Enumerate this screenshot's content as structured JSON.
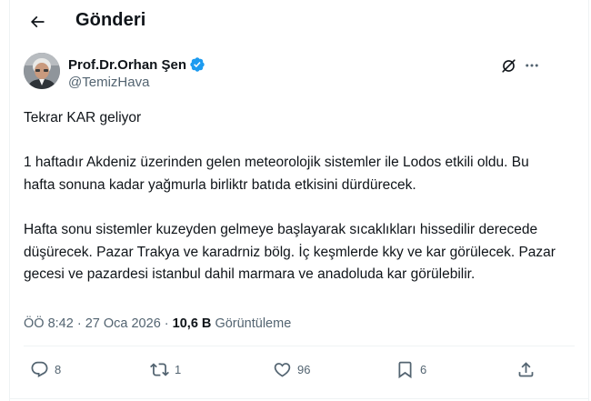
{
  "header": {
    "back_icon": "arrow-left-icon",
    "title": "Gönderi"
  },
  "author": {
    "name": "Prof.Dr.Orhan Şen",
    "handle": "@TemizHava",
    "verified": true,
    "verified_color": "#1d9bf0"
  },
  "tweet": {
    "paragraphs": [
      "Tekrar KAR geliyor",
      "1 haftadır Akdeniz üzerinden gelen meteorolojik sistemler ile Lodos etkili oldu. Bu hafta sonuna kadar yağmurla birliktr batıda etkisini dürdürecek.",
      "Hafta sonu sistemler kuzeyden gelmeye başlayarak sıcaklıkları hissedilir derecede düşürecek. Pazar Trakya ve karadrniz bölg. İç keşmlerde kky ve kar görülecek. Pazar gecesi ve pazardesi istanbul dahil marmara ve anadoluda kar görülebilir."
    ]
  },
  "meta": {
    "time": "ÖÖ 8:42",
    "separator": "·",
    "date": "27 Oca 2026",
    "views_count": "10,6 B",
    "views_label": "Görüntüleme"
  },
  "actions": {
    "replies": "8",
    "reposts": "1",
    "likes": "96",
    "bookmarks": "6"
  },
  "colors": {
    "text_primary": "#0f1419",
    "text_secondary": "#536471",
    "border": "#eff3f4",
    "accent": "#1d9bf0"
  }
}
